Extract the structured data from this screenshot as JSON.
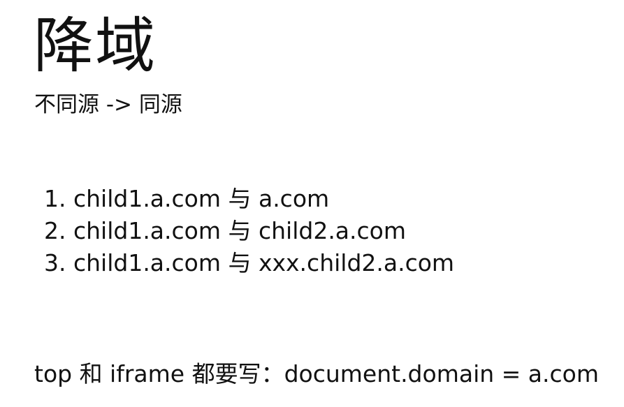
{
  "title": "降域",
  "subtitle": "不同源 -> 同源",
  "cases": [
    "1. child1.a.com 与 a.com",
    "2. child1.a.com 与 child2.a.com",
    "3. child1.a.com 与 xxx.child2.a.com"
  ],
  "note": "top 和 iframe 都要写：document.domain = a.com"
}
